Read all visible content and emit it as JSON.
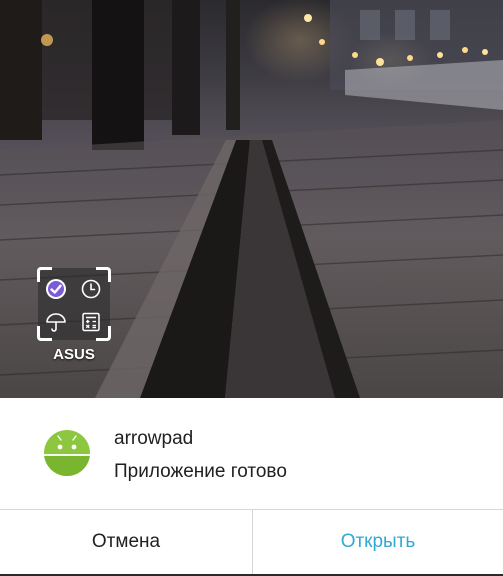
{
  "launcher": {
    "folder_label": "ASUS",
    "folder_icons": [
      "checkmark-circle-icon",
      "clock-icon",
      "umbrella-icon",
      "calculator-icon"
    ]
  },
  "dialog": {
    "app_name": "arrowpad",
    "status": "Приложение готово",
    "app_icon": "android-robot-icon",
    "cancel_label": "Отмена",
    "open_label": "Открыть"
  },
  "colors": {
    "accent": "#33a8d4",
    "text": "#212121",
    "android_green": "#8dc63f",
    "check_purple": "#7b5bd6"
  }
}
